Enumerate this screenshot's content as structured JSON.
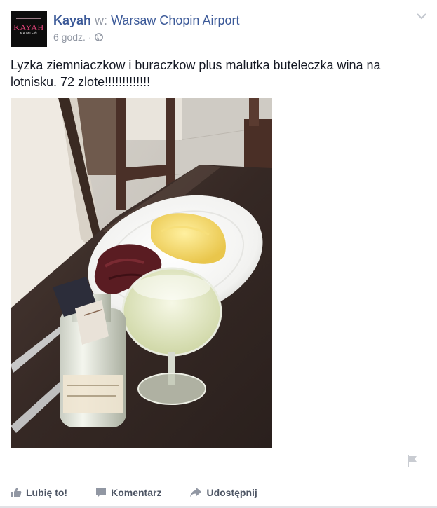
{
  "post": {
    "avatar_logo": "KAYAH",
    "avatar_logo_sub": "KAMIEŃ",
    "author": "Kayah",
    "at_label": "w:",
    "place": "Warsaw Chopin Airport",
    "timestamp": "6 godz.",
    "separator": "·",
    "audience_icon": "globe-icon",
    "message": "Lyzka ziemniaczkow i buraczkow plus malutka buteleczka wina na lotnisku. 72 zlote!!!!!!!!!!!!!",
    "photo_alt": "Plate with mashed potatoes, beetroot, small wine bottle and a glass of white wine on a restaurant table"
  },
  "actions": {
    "like_label": "Lubię to!",
    "comment_label": "Komentarz",
    "share_label": "Udostępnij"
  },
  "colors": {
    "link": "#3b5998",
    "meta": "#9197a3",
    "text": "#141823",
    "action": "#4e5665"
  }
}
